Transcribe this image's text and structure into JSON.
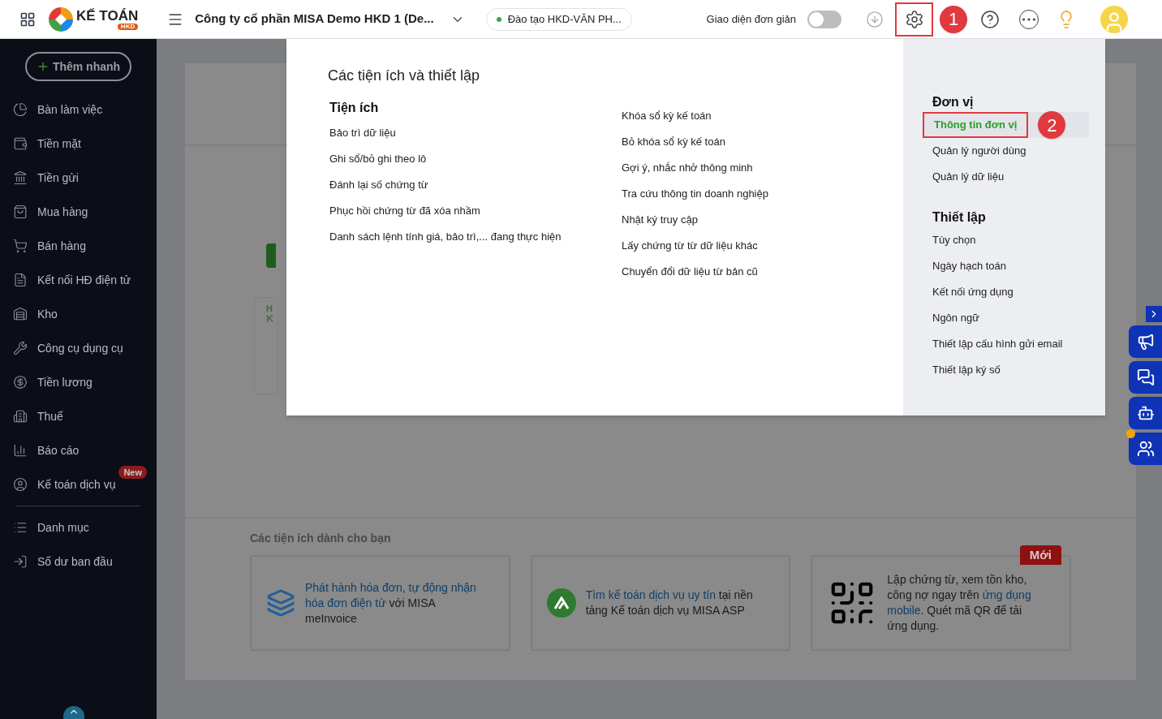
{
  "header": {
    "brand": "KẾ TOÁN",
    "brand_badge": "HKD",
    "company": "Công ty cổ phần MISA Demo HKD 1 (De...",
    "branch": "Đào tạo HKD-VĂN PH...",
    "simple_mode_label": "Giao diện đơn giản",
    "simple_mode_on": false
  },
  "sidebar": {
    "quick_add": "Thêm nhanh",
    "items": [
      {
        "label": "Bàn làm việc"
      },
      {
        "label": "Tiền mặt"
      },
      {
        "label": "Tiền gửi"
      },
      {
        "label": "Mua hàng"
      },
      {
        "label": "Bán hàng"
      },
      {
        "label": "Kết nối HĐ điện tử"
      },
      {
        "label": "Kho"
      },
      {
        "label": "Công cụ dụng cụ"
      },
      {
        "label": "Tiền lương"
      },
      {
        "label": "Thuế"
      },
      {
        "label": "Báo cáo"
      },
      {
        "label": "Kế toán dịch vụ",
        "badge": "New"
      }
    ],
    "items2": [
      {
        "label": "Danh mục"
      },
      {
        "label": "Số dư ban đầu"
      }
    ]
  },
  "background": {
    "card_letters": [
      "H",
      "K"
    ]
  },
  "settings_menu": {
    "title": "Các tiện ích và thiết lập",
    "utilities": {
      "heading": "Tiện ích",
      "column_1": [
        "Bảo trì dữ liệu",
        "Ghi sổ/bỏ ghi theo lô",
        "Đánh lại số chứng từ",
        "Phục hồi chứng từ đã xóa nhầm",
        "Danh sách lệnh tính giá, bảo trì,... đang thực hiện"
      ],
      "column_2": [
        "Khóa sổ kỳ kế toán",
        "Bỏ khóa sổ kỳ kế toán",
        "Gợi ý, nhắc nhở thông minh",
        "Tra cứu thông tin doanh nghiệp",
        "Nhật ký truy cập",
        "Lấy chứng từ từ dữ liệu khác",
        "Chuyển đổi dữ liệu từ bản cũ"
      ]
    },
    "sections": [
      {
        "heading": "Đơn vị",
        "items": [
          {
            "label": "Thông tin đơn vị",
            "selected": true
          },
          {
            "label": "Quản lý người dùng",
            "selected": false
          },
          {
            "label": "Quản lý dữ liệu",
            "selected": false
          }
        ]
      },
      {
        "heading": "Thiết lập",
        "items": [
          {
            "label": "Tùy chọn",
            "selected": false
          },
          {
            "label": "Ngày hạch toán",
            "selected": false
          },
          {
            "label": "Kết nối ứng dụng",
            "selected": false
          },
          {
            "label": "Ngôn ngữ",
            "selected": false
          },
          {
            "label": "Thiết lập cấu hình gửi email",
            "selected": false
          },
          {
            "label": "Thiết lập ký số",
            "selected": false
          }
        ]
      }
    ]
  },
  "annotations": [
    "1",
    "2"
  ],
  "utilities_for_you": {
    "title": "Các tiện ích dành cho bạn",
    "cards": [
      {
        "kind": "invoice",
        "lines": [
          [
            {
              "text": "Phát hành hóa đơn, tự động nhận",
              "link": true
            }
          ],
          [
            {
              "text": "hóa đơn điện tử",
              "link": true
            },
            {
              "text": " với MISA",
              "link": false
            }
          ],
          [
            {
              "text": "meInvoice",
              "link": false
            }
          ]
        ]
      },
      {
        "kind": "asp",
        "lines": [
          [
            {
              "text": "Tìm kế toán dịch vụ uy tín",
              "link": true
            },
            {
              "text": " tại nền",
              "link": false
            }
          ],
          [
            {
              "text": "tảng Kế toán dịch vụ MISA ASP",
              "link": false
            }
          ]
        ]
      },
      {
        "kind": "qr",
        "ribbon": "Mới",
        "lines": [
          [
            {
              "text": "Lập chứng từ, xem tồn kho,",
              "link": false
            }
          ],
          [
            {
              "text": "công nợ ngay trên ",
              "link": false
            },
            {
              "text": "ứng dụng",
              "link": true
            }
          ],
          [
            {
              "text": "mobile",
              "link": true
            },
            {
              "text": ". Quét mã QR để tải",
              "link": false
            }
          ],
          [
            {
              "text": "ứng dụng.",
              "link": false
            }
          ]
        ]
      }
    ]
  }
}
